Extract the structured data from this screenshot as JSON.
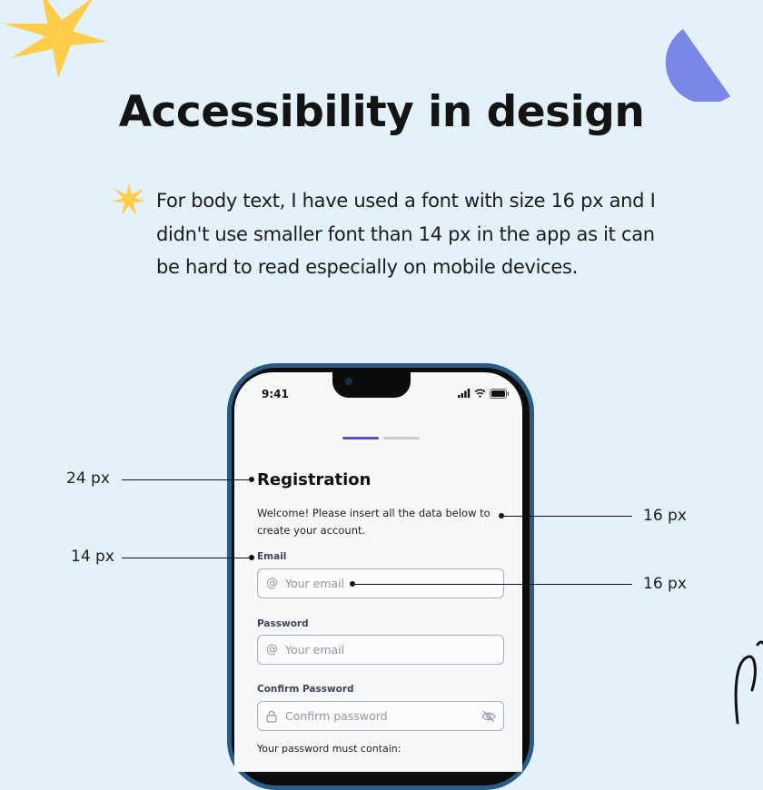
{
  "title": "Accessibility in design",
  "body_text": "For body text, I have used a font with size 16 px and I didn't use smaller font than 14 px in the app as it can be hard to read especially on mobile devices.",
  "colors": {
    "background": "#e3f1fb",
    "star": "#ffcd4c",
    "halfmoon": "#7b87e6",
    "phone_frame": "#2b5a82",
    "progress_active": "#5a4fc4"
  },
  "phone": {
    "status_time": "9:41",
    "registration_title": "Registration",
    "welcome_text": "Welcome! Please insert all the data below to create your account.",
    "email_label": "Email",
    "email_placeholder": "Your email",
    "password_label": "Password",
    "password_placeholder": "Your email",
    "confirm_label": "Confirm Password",
    "confirm_placeholder": "Confirm password",
    "must_contain": "Your password must contain:",
    "icons": [
      "at-icon",
      "at-icon",
      "lock-icon",
      "eye-off-icon",
      "signal-icon",
      "wifi-icon",
      "battery-icon"
    ]
  },
  "annotations": {
    "title_size": "24 px",
    "body_size": "16 px",
    "label_size": "14 px",
    "input_size": "16 px"
  }
}
